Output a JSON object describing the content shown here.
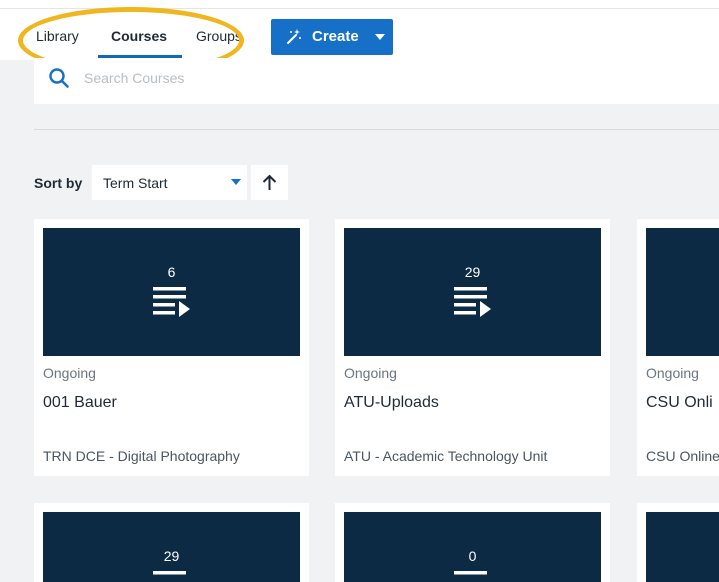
{
  "nav": {
    "tabs": [
      {
        "label": "Library"
      },
      {
        "label": "Courses",
        "active": true
      },
      {
        "label": "Groups"
      }
    ],
    "create_button": {
      "label": "Create",
      "icon": "magic-wand-icon"
    }
  },
  "search": {
    "placeholder": "Search Courses",
    "value": ""
  },
  "sort": {
    "label": "Sort by",
    "selected": "Term Start",
    "direction": "ascending"
  },
  "colors": {
    "accent": "#1670c8",
    "thumbnail": "#0d2a45",
    "highlight_ring": "#f0b620"
  },
  "cards": [
    {
      "count": "6",
      "status": "Ongoing",
      "title": "001 Bauer",
      "org": "TRN DCE - Digital Photography"
    },
    {
      "count": "29",
      "status": "Ongoing",
      "title": "ATU-Uploads",
      "org": "ATU - Academic Technology Unit"
    },
    {
      "count": "",
      "status": "Ongoing",
      "title": "CSU Onli",
      "org": "CSU Online"
    },
    {
      "count": "29",
      "status": "",
      "title": "",
      "org": ""
    },
    {
      "count": "0",
      "status": "",
      "title": "",
      "org": ""
    },
    {
      "count": "",
      "status": "",
      "title": "",
      "org": ""
    }
  ]
}
